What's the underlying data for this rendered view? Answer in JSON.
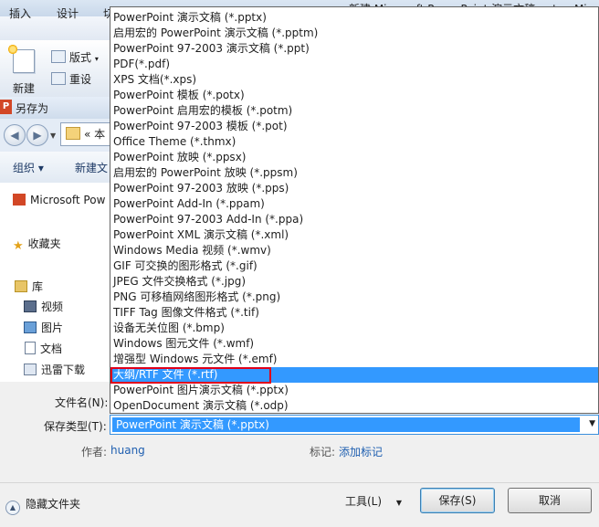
{
  "app": {
    "title": "新建 Microsoft PowerPoint 演示文稿.pptx - Mic",
    "tabs": [
      "插入",
      "设计",
      "切"
    ],
    "ribbon": {
      "new_label": "新建",
      "layout_label": "版式",
      "reset_label": "重设"
    }
  },
  "dialog": {
    "title": "另存为",
    "icon_letter": "P",
    "address_text": "« 本",
    "toolbar": {
      "organize": "组织 ▾",
      "new_folder": "新建文"
    },
    "nav_pane": [
      {
        "label": "Microsoft Pow",
        "icon": "powerpoint-icon"
      },
      {
        "label": "收藏夹",
        "icon": "star-icon"
      },
      {
        "label": "库",
        "icon": "library-icon"
      },
      {
        "label": "视频",
        "icon": "video-icon"
      },
      {
        "label": "图片",
        "icon": "picture-icon"
      },
      {
        "label": "文档",
        "icon": "document-icon"
      },
      {
        "label": "迅雷下载",
        "icon": "download-icon"
      }
    ],
    "filename_label": "文件名(N):",
    "savetype_label": "保存类型(T):",
    "savetype_value": "PowerPoint 演示文稿 (*.pptx)",
    "author_label": "作者:",
    "author_value": "huang",
    "tags_label": "标记:",
    "tags_value": "添加标记",
    "hide_folders": "隐藏文件夹",
    "tools": "工具(L)",
    "save": "保存(S)",
    "cancel": "取消"
  },
  "dropdown": {
    "selected_index": 23,
    "highlight_color": "#3399ff",
    "outline_color": "#e0001a",
    "options": [
      "PowerPoint 演示文稿 (*.pptx)",
      "启用宏的 PowerPoint 演示文稿 (*.pptm)",
      "PowerPoint 97-2003 演示文稿 (*.ppt)",
      "PDF(*.pdf)",
      "XPS 文档(*.xps)",
      "PowerPoint 模板 (*.potx)",
      "PowerPoint 启用宏的模板 (*.potm)",
      "PowerPoint 97-2003 模板 (*.pot)",
      "Office Theme (*.thmx)",
      "PowerPoint 放映 (*.ppsx)",
      "启用宏的 PowerPoint 放映 (*.ppsm)",
      "PowerPoint 97-2003 放映 (*.pps)",
      "PowerPoint Add-In (*.ppam)",
      "PowerPoint 97-2003 Add-In (*.ppa)",
      "PowerPoint XML 演示文稿 (*.xml)",
      "Windows Media 视频 (*.wmv)",
      "GIF 可交换的图形格式 (*.gif)",
      "JPEG 文件交换格式 (*.jpg)",
      "PNG 可移植网络图形格式 (*.png)",
      "TIFF Tag 图像文件格式 (*.tif)",
      "设备无关位图 (*.bmp)",
      "Windows 图元文件 (*.wmf)",
      "增强型 Windows 元文件 (*.emf)",
      "大纲/RTF 文件 (*.rtf)",
      "PowerPoint 图片演示文稿 (*.pptx)",
      "OpenDocument 演示文稿 (*.odp)"
    ]
  }
}
